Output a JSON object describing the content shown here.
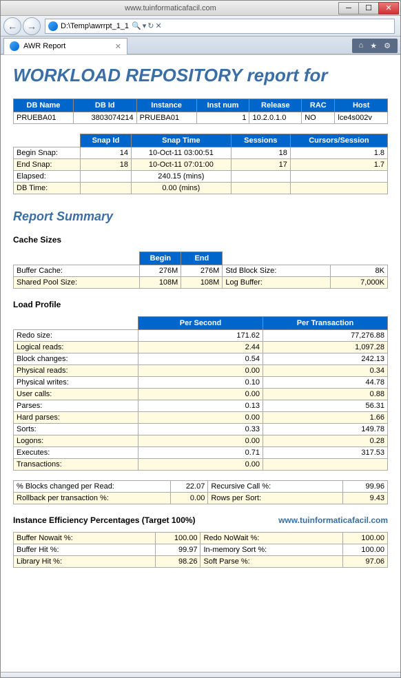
{
  "window": {
    "title": "www.tuinformaticafacil.com",
    "url": "D:\\Temp\\awrrpt_1_1",
    "tab_title": "AWR Report"
  },
  "main_heading": "WORKLOAD REPOSITORY report for",
  "dbinfo": {
    "headers": [
      "DB Name",
      "DB Id",
      "Instance",
      "Inst num",
      "Release",
      "RAC",
      "Host"
    ],
    "row": [
      "PRUEBA01",
      "3803074214",
      "PRUEBA01",
      "1",
      "10.2.0.1.0",
      "NO",
      "lce4s002v"
    ]
  },
  "snap": {
    "headers": [
      "",
      "Snap Id",
      "Snap Time",
      "Sessions",
      "Cursors/Session"
    ],
    "rows": [
      {
        "label": "Begin Snap:",
        "id": "14",
        "time": "10-Oct-11 03:00:51",
        "sess": "18",
        "curs": "1.8"
      },
      {
        "label": "End Snap:",
        "id": "18",
        "time": "10-Oct-11 07:01:00",
        "sess": "17",
        "curs": "1.7"
      },
      {
        "label": "Elapsed:",
        "id": "",
        "time": "240.15 (mins)",
        "sess": "",
        "curs": ""
      },
      {
        "label": "DB Time:",
        "id": "",
        "time": "0.00 (mins)",
        "sess": "",
        "curs": ""
      }
    ]
  },
  "section_summary": "Report Summary",
  "cache_title": "Cache Sizes",
  "cache": {
    "col_begin": "Begin",
    "col_end": "End",
    "rows": [
      {
        "l": "Buffer Cache:",
        "b": "276M",
        "e": "276M",
        "l2": "Std Block Size:",
        "v2": "8K"
      },
      {
        "l": "Shared Pool Size:",
        "b": "108M",
        "e": "108M",
        "l2": "Log Buffer:",
        "v2": "7,000K"
      }
    ]
  },
  "load_title": "Load Profile",
  "load": {
    "col1": "Per Second",
    "col2": "Per Transaction",
    "rows": [
      {
        "l": "Redo size:",
        "s": "171.62",
        "t": "77,276.88"
      },
      {
        "l": "Logical reads:",
        "s": "2.44",
        "t": "1,097.28"
      },
      {
        "l": "Block changes:",
        "s": "0.54",
        "t": "242.13"
      },
      {
        "l": "Physical reads:",
        "s": "0.00",
        "t": "0.34"
      },
      {
        "l": "Physical writes:",
        "s": "0.10",
        "t": "44.78"
      },
      {
        "l": "User calls:",
        "s": "0.00",
        "t": "0.88"
      },
      {
        "l": "Parses:",
        "s": "0.13",
        "t": "56.31"
      },
      {
        "l": "Hard parses:",
        "s": "0.00",
        "t": "1.66"
      },
      {
        "l": "Sorts:",
        "s": "0.33",
        "t": "149.78"
      },
      {
        "l": "Logons:",
        "s": "0.00",
        "t": "0.28"
      },
      {
        "l": "Executes:",
        "s": "0.71",
        "t": "317.53"
      },
      {
        "l": "Transactions:",
        "s": "0.00",
        "t": ""
      }
    ]
  },
  "blocks": {
    "rows": [
      {
        "l": "% Blocks changed per Read:",
        "v": "22.07",
        "l2": "Recursive Call %:",
        "v2": "99.96"
      },
      {
        "l": "Rollback per transaction %:",
        "v": "0.00",
        "l2": "Rows per Sort:",
        "v2": "9.43"
      }
    ]
  },
  "eff_title": "Instance Efficiency Percentages (Target 100%)",
  "watermark": "www.tuinformaticafacil.com",
  "eff": {
    "rows": [
      {
        "l": "Buffer Nowait %:",
        "v": "100.00",
        "l2": "Redo NoWait %:",
        "v2": "100.00"
      },
      {
        "l": "Buffer Hit %:",
        "v": "99.97",
        "l2": "In-memory Sort %:",
        "v2": "100.00"
      },
      {
        "l": "Library Hit %:",
        "v": "98.26",
        "l2": "Soft Parse %:",
        "v2": "97.06"
      }
    ]
  }
}
